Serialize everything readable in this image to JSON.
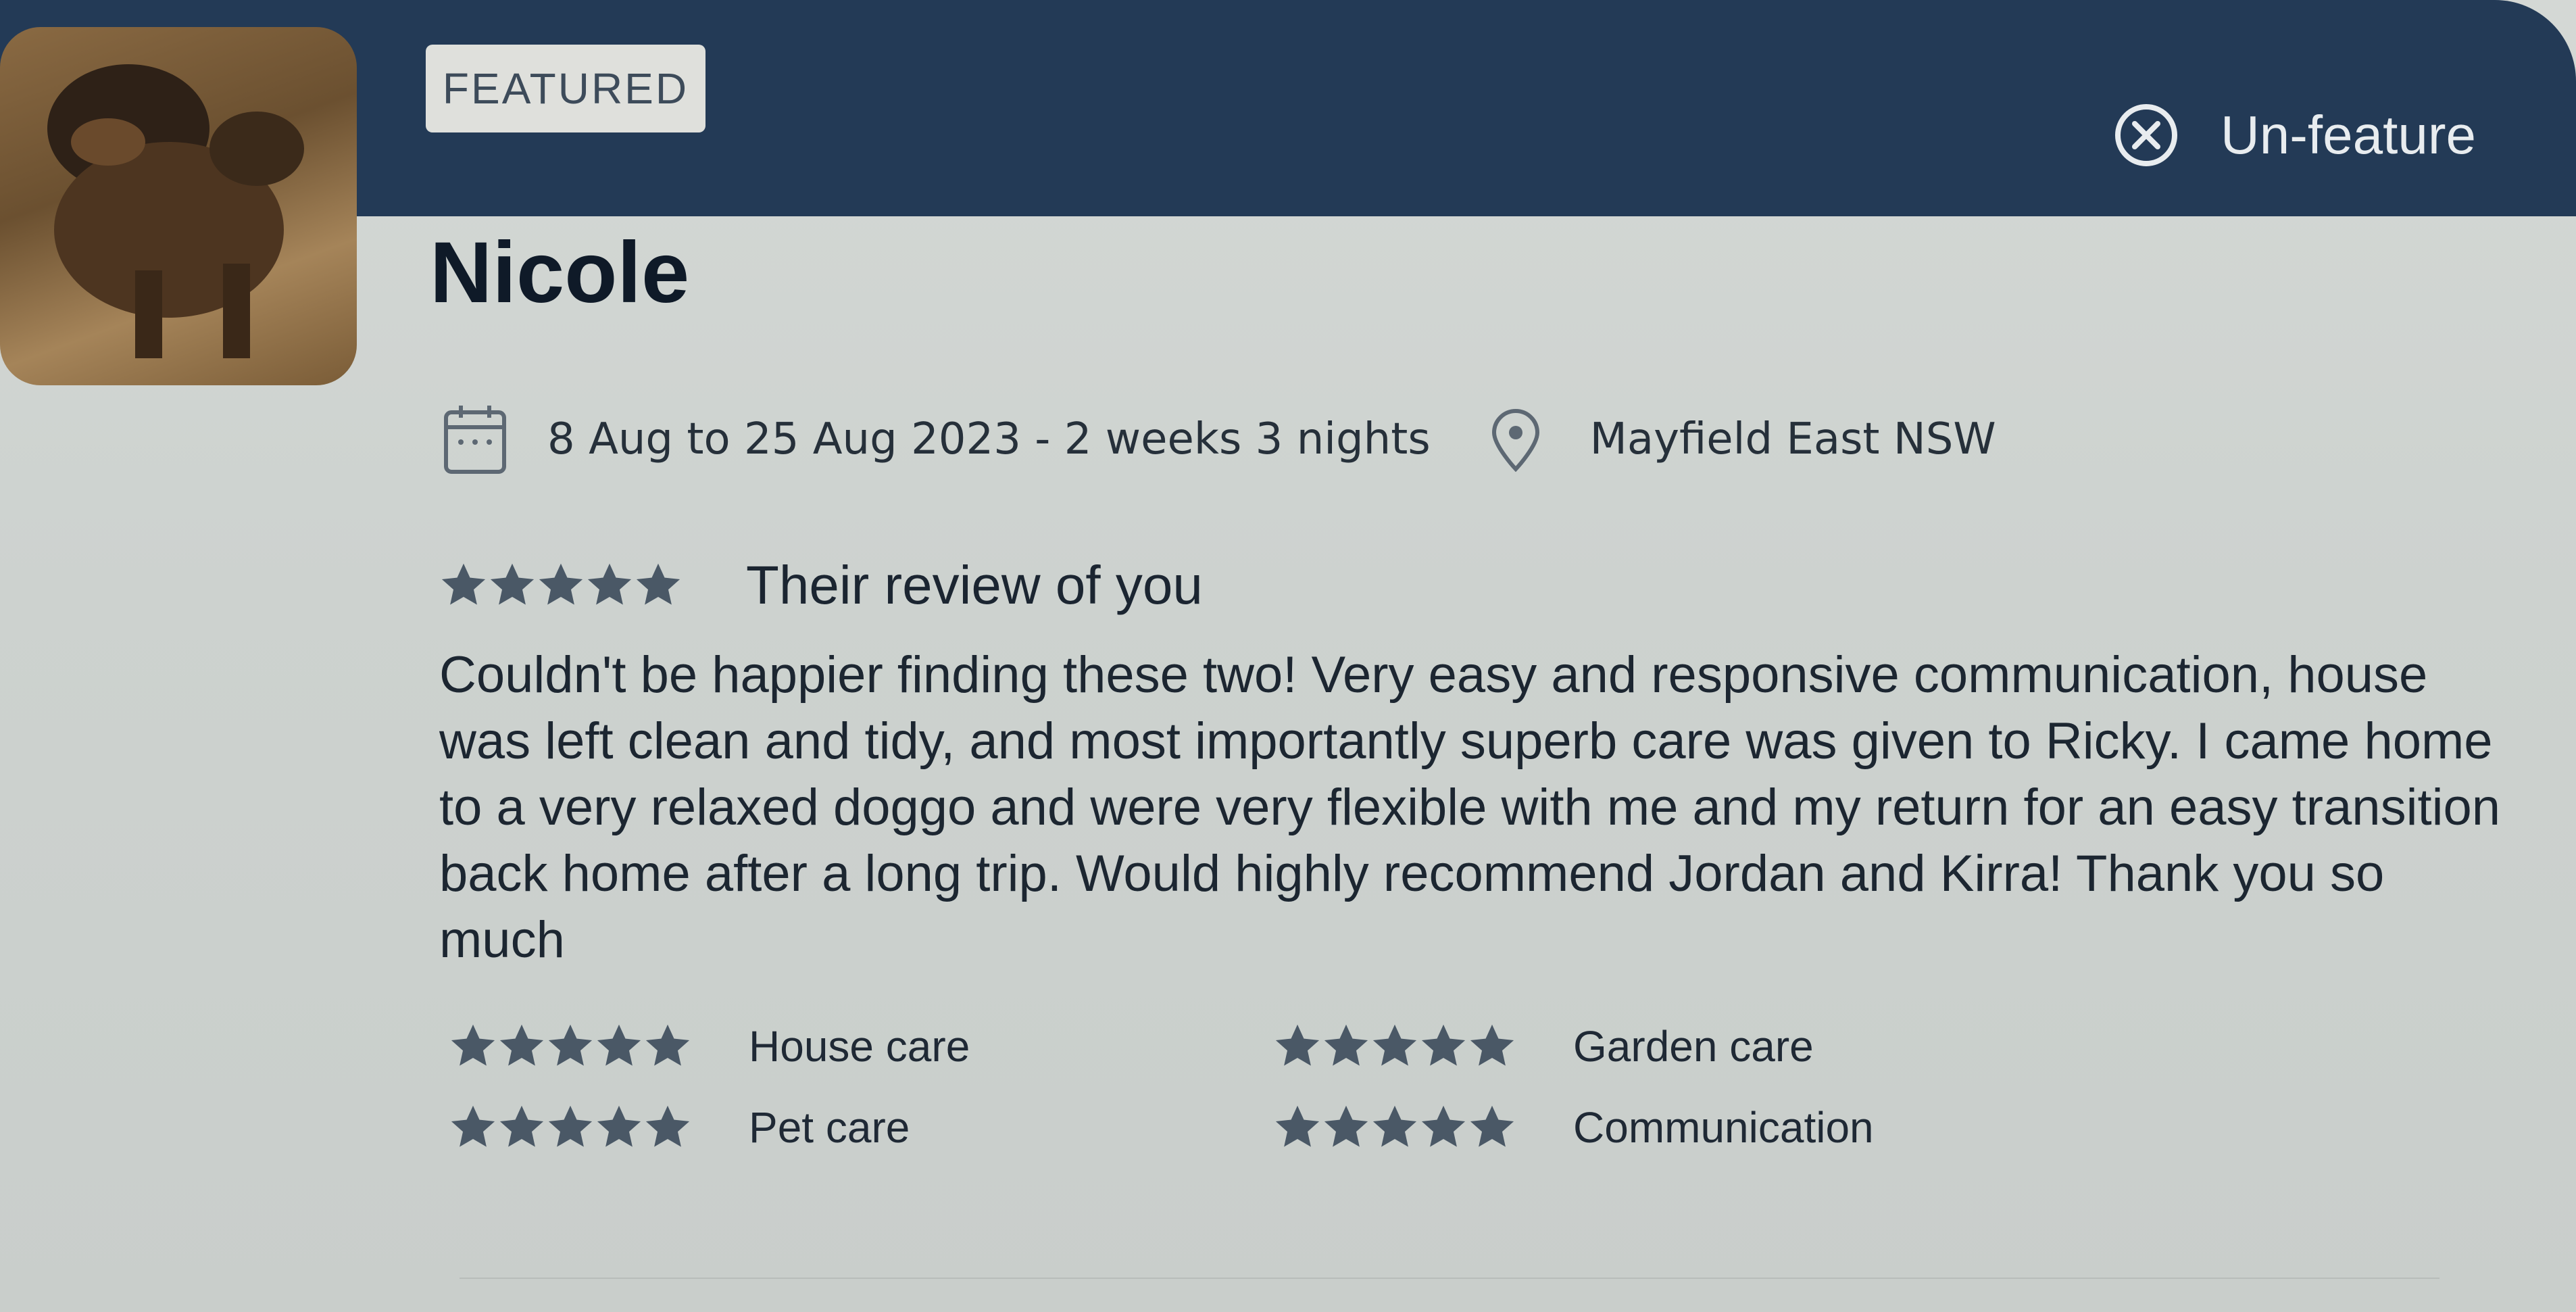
{
  "badge": {
    "label": "FEATURED"
  },
  "action": {
    "label": "Un-feature",
    "icon": "close-circle-icon"
  },
  "reviewer": {
    "name": "Nicole",
    "avatar": "dog-photo"
  },
  "stay": {
    "dates": "8 Aug to 25 Aug 2023 - 2 weeks 3 nights",
    "location": "Mayfield East NSW",
    "date_icon": "calendar-icon",
    "location_icon": "location-pin-icon"
  },
  "review": {
    "heading": "Their review of you",
    "rating": 5,
    "text": "Couldn't be happier finding these two! Very easy and responsive communication, house was left clean and tidy, and most importantly superb care was given to Ricky. I came home to a very relaxed doggo and were very flexible with me and my return for an easy transition back home after a long trip. Would highly recommend Jordan and Kirra! Thank you so much"
  },
  "ratings": [
    {
      "label": "House care",
      "rating": 5
    },
    {
      "label": "Garden care",
      "rating": 5
    },
    {
      "label": "Pet care",
      "rating": 5
    },
    {
      "label": "Communication",
      "rating": 5
    }
  ],
  "colors": {
    "header": "#233a56",
    "star": "#4a5866",
    "text": "#1c2631"
  }
}
